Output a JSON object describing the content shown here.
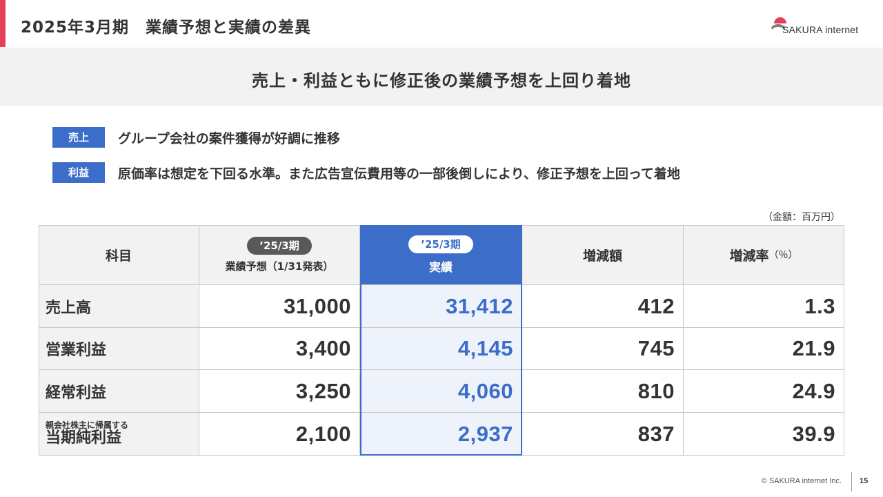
{
  "header": {
    "title": "2025年3月期　業績予想と実績の差異",
    "logo_text": "SAKURA internet",
    "accent_color": "#e83e59"
  },
  "banner": {
    "text": "売上・利益ともに修正後の業績予想を上回り着地"
  },
  "points": [
    {
      "tag": "売上",
      "text": "グループ会社の案件獲得が好調に推移"
    },
    {
      "tag": "利益",
      "text": "原価率は想定を下回る水準。また広告宣伝費用等の一部後倒しにより、修正予想を上回って着地"
    }
  ],
  "table": {
    "unit": "（金額：百万円）",
    "headers": {
      "item": "科目",
      "forecast_pill": "’25/3期",
      "forecast_label": "業績予想（1/31発表）",
      "actual_pill": "’25/3期",
      "actual_label": "実績",
      "diff": "増減額",
      "rate": "増減率",
      "rate_unit": "（％）"
    },
    "rows": [
      {
        "item": "売上高",
        "item_note": "",
        "forecast": "31,000",
        "actual": "31,412",
        "diff": "412",
        "rate": "1.3"
      },
      {
        "item": "営業利益",
        "item_note": "",
        "forecast": "3,400",
        "actual": "4,145",
        "diff": "745",
        "rate": "21.9"
      },
      {
        "item": "経常利益",
        "item_note": "",
        "forecast": "3,250",
        "actual": "4,060",
        "diff": "810",
        "rate": "24.9"
      },
      {
        "item": "当期純利益",
        "item_note": "親会社株主に帰属する",
        "forecast": "2,100",
        "actual": "2,937",
        "diff": "837",
        "rate": "39.9"
      }
    ],
    "actual_color": "#3b6dc9"
  },
  "footer": {
    "copyright": "© SAKURA internet Inc.",
    "page": "15"
  }
}
